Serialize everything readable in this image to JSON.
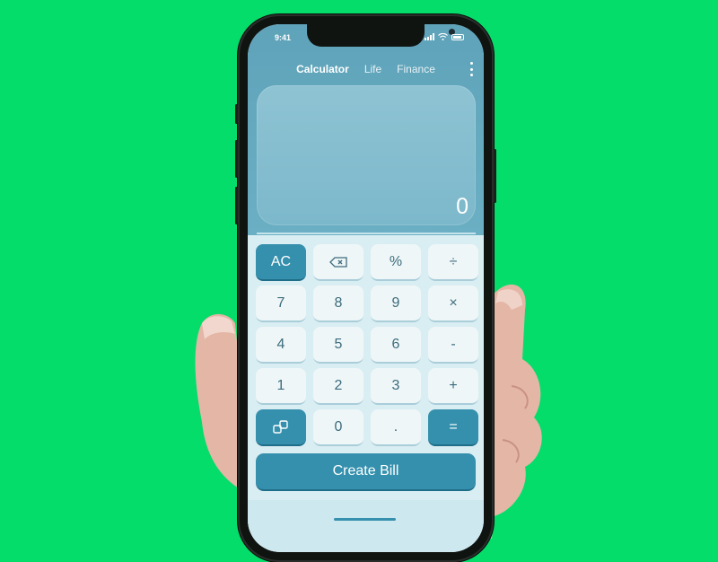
{
  "status_bar": {
    "time": "9:41"
  },
  "tabs": [
    {
      "label": "Calculator",
      "active": true
    },
    {
      "label": "Life",
      "active": false
    },
    {
      "label": "Finance",
      "active": false
    }
  ],
  "display": {
    "value": "0"
  },
  "keypad": {
    "row1": [
      "AC",
      "backspace",
      "%",
      "÷"
    ],
    "row2": [
      "7",
      "8",
      "9",
      "×"
    ],
    "row3": [
      "4",
      "5",
      "6",
      "-"
    ],
    "row4": [
      "1",
      "2",
      "3",
      "+"
    ],
    "row5": [
      "convert",
      "0",
      ".",
      "="
    ]
  },
  "labels": {
    "ac": "AC",
    "percent": "%",
    "divide": "÷",
    "seven": "7",
    "eight": "8",
    "nine": "9",
    "multiply": "×",
    "four": "4",
    "five": "5",
    "six": "6",
    "minus": "-",
    "one": "1",
    "two": "2",
    "three": "3",
    "plus": "+",
    "zero": "0",
    "dot": ".",
    "equals": "="
  },
  "create_bill": {
    "label": "Create Bill"
  },
  "colors": {
    "background": "#04dd6a",
    "accent": "#3590ad",
    "display": "#7cb8cb"
  }
}
